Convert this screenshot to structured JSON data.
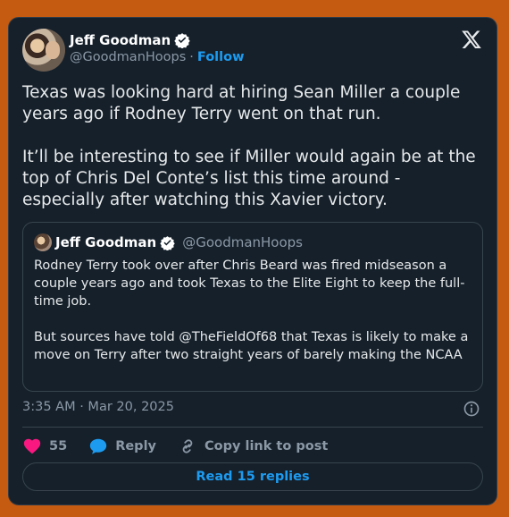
{
  "author": {
    "name": "Jeff Goodman",
    "handle": "@GoodmanHoops",
    "separator": "·",
    "follow_label": "Follow"
  },
  "tweet": {
    "text": "Texas was looking hard at hiring Sean Miller a couple years ago if Rodney Terry went on that run.\n\nIt’ll be interesting to see if Miller would again be at the top of Chris Del Conte’s list this time around - especially after watching this Xavier victory."
  },
  "quoted_tweet": {
    "name": "Jeff Goodman",
    "handle": "@GoodmanHoops",
    "text": "Rodney Terry took over after Chris Beard was fired midseason a couple years ago and took Texas to the Elite Eight to keep the full-time job.\n\nBut sources have told @TheFieldOf68 that Texas is likely to make a move on Terry after two straight years of barely making the NCAA"
  },
  "timestamp": "3:35 AM · Mar 20, 2025",
  "actions": {
    "like_count": "55",
    "reply_label": "Reply",
    "copy_link_label": "Copy link to post"
  },
  "read_replies_label": "Read 15 replies",
  "colors": {
    "background": "#c55a11",
    "card": "#15202b",
    "accent": "#1d9bf0",
    "like": "#f91880",
    "muted": "#8b98a5"
  },
  "icons": [
    "x-logo-icon",
    "verified-badge-icon",
    "info-icon",
    "heart-icon",
    "reply-bubble-icon",
    "link-icon"
  ]
}
